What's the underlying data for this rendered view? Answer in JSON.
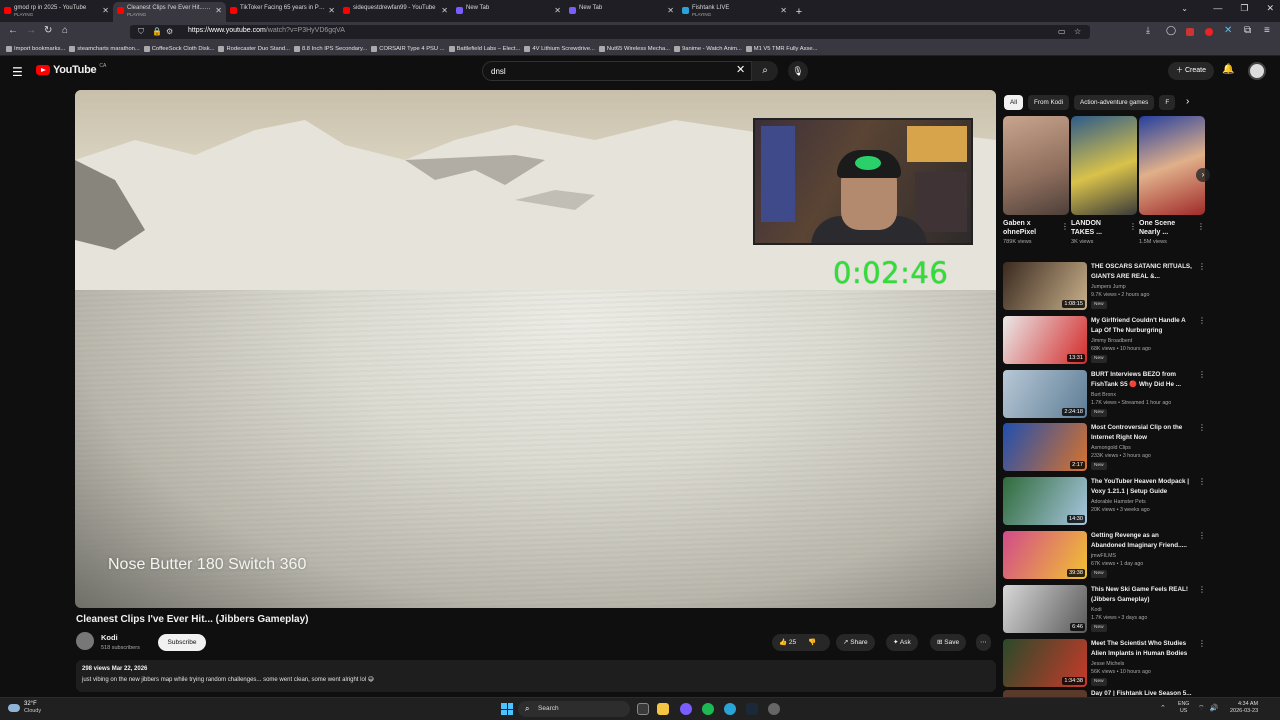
{
  "browser": {
    "tabs": [
      {
        "title": "gmod rp in 2025 - YouTube",
        "sub": "PLAYING",
        "fav": "youtube-icon",
        "active": false
      },
      {
        "title": "Cleanest Clips I've Ever Hit... (Ji",
        "sub": "PLAYING",
        "fav": "youtube-icon",
        "active": true
      },
      {
        "title": "TikToker Facing 65 years in Priso",
        "sub": "",
        "fav": "youtube-icon",
        "active": false
      },
      {
        "title": "sidequestdrewfan99 - YouTube",
        "sub": "",
        "fav": "youtube-icon",
        "active": false
      },
      {
        "title": "New Tab",
        "sub": "",
        "fav": "firefox-icon",
        "active": false
      },
      {
        "title": "New Tab",
        "sub": "",
        "fav": "firefox-icon",
        "active": false
      },
      {
        "title": "Fishtank LIVE",
        "sub": "PLAYING",
        "fav": "fishtank-icon",
        "active": false
      }
    ],
    "url_host": "https://www.youtube.com",
    "url_path": "/watch?v=P3HyVD6gqVA",
    "bookmarks": [
      "Import bookmarks...",
      "steamcharts marathon...",
      "CoffeeSock Cloth Disk...",
      "Rodecaster Duo Stand...",
      "8.8 Inch IPS Secondary...",
      "CORSAIR Type 4 PSU ...",
      "Battlefield Labs – Elect...",
      "4V Lithium Screwdrive...",
      "Nut65 Wireless Mecha...",
      "9anime - Watch Anim...",
      "M1 V5 TMR Fully Asse..."
    ]
  },
  "youtube": {
    "logo_text": "YouTube",
    "logo_region": "CA",
    "search_value": "dnsl",
    "create_label": "Create"
  },
  "player": {
    "timer": "0:02:46",
    "caption": "Nose Butter 180 Switch 360"
  },
  "video": {
    "title": "Cleanest Clips I've Ever Hit... (Jibbers Gameplay)",
    "channel": "Kodi",
    "subscribers": "518 subscribers",
    "subscribe_label": "Subscribe",
    "likes": "25",
    "share_label": "Share",
    "ask_label": "Ask",
    "save_label": "Save",
    "views_date": "298 views  Mar 22, 2026",
    "description": "just vibing on the new jibbers map while trying random challenges... some went clean, some went alright lol 😅"
  },
  "sidebar": {
    "chips": [
      "All",
      "From Kodi",
      "Action-adventure games",
      "F"
    ],
    "shorts": [
      {
        "title": "Gaben x ohnePixel",
        "views": "789K views"
      },
      {
        "title": "LANDON TAKES ...",
        "views": "3K views"
      },
      {
        "title": "One Scene Nearly ...",
        "views": "1.5M views"
      }
    ],
    "recommended": [
      {
        "title": "THE OSCARS SATANIC RITUALS, GIANTS ARE REAL &...",
        "channel": "Jumpers Jump",
        "meta": "9.7K views • 2 hours ago",
        "badge": "New",
        "duration": "1:08:15",
        "color1": "#3a2a20",
        "color2": "#c9b08a"
      },
      {
        "title": "My Girlfriend Couldn't Handle A Lap Of The Nurburgring",
        "channel": "Jimmy Broadbent",
        "meta": "68K views • 10 hours ago",
        "badge": "New",
        "duration": "13:31",
        "color1": "#e9e9e9",
        "color2": "#d42b2b"
      },
      {
        "title": "BURT Interviews BEZO from FishTank S5 🔴 Why Did He ...",
        "channel": "Burt Bronx",
        "meta": "1.7K views • Streamed 1 hour ago",
        "badge": "New",
        "duration": "2:24:18",
        "color1": "#b8c8d6",
        "color2": "#5d7d96"
      },
      {
        "title": "Most Controversial Clip on the Internet Right Now",
        "channel": "Asmongold Clips",
        "meta": "233K views • 3 hours ago",
        "badge": "New",
        "duration": "2:17",
        "color1": "#1f4fb0",
        "color2": "#d9732b"
      },
      {
        "title": "The YouTuber Heaven Modpack | Voxy 1.21.1 | Setup Guide",
        "channel": "Adorable Hamster Pets",
        "meta": "20K views • 3 weeks ago",
        "badge": "",
        "duration": "14:30",
        "color1": "#2f6b3a",
        "color2": "#a8c6e0"
      },
      {
        "title": "Getting Revenge as an Abandoned Imaginary Friend.....",
        "channel": "jmwFILMS",
        "meta": "67K views • 1 day ago",
        "badge": "New",
        "duration": "39:38",
        "color1": "#d24b8a",
        "color2": "#f2c232"
      },
      {
        "title": "This New Ski Game Feels REAL! (Jibbers Gameplay)",
        "channel": "Kodi",
        "meta": "1.7K views • 3 days ago",
        "badge": "New",
        "duration": "6:46",
        "color1": "#d8d8d8",
        "color2": "#5a5a5a"
      },
      {
        "title": "Meet The Scientist Who Studies Alien Implants in Human Bodies",
        "channel": "Jesse Michels",
        "meta": "56K views • 10 hours ago",
        "badge": "New",
        "duration": "1:34:38",
        "color1": "#2a4a2a",
        "color2": "#c83a2a"
      }
    ],
    "partial_title": "Day 07 | Fishtank Live Season 5..."
  },
  "taskbar": {
    "temp": "32°F",
    "condition": "Cloudy",
    "search_label": "Search",
    "lang1": "ENG",
    "lang2": "US",
    "time": "4:34 AM",
    "date": "2026-03-23"
  }
}
